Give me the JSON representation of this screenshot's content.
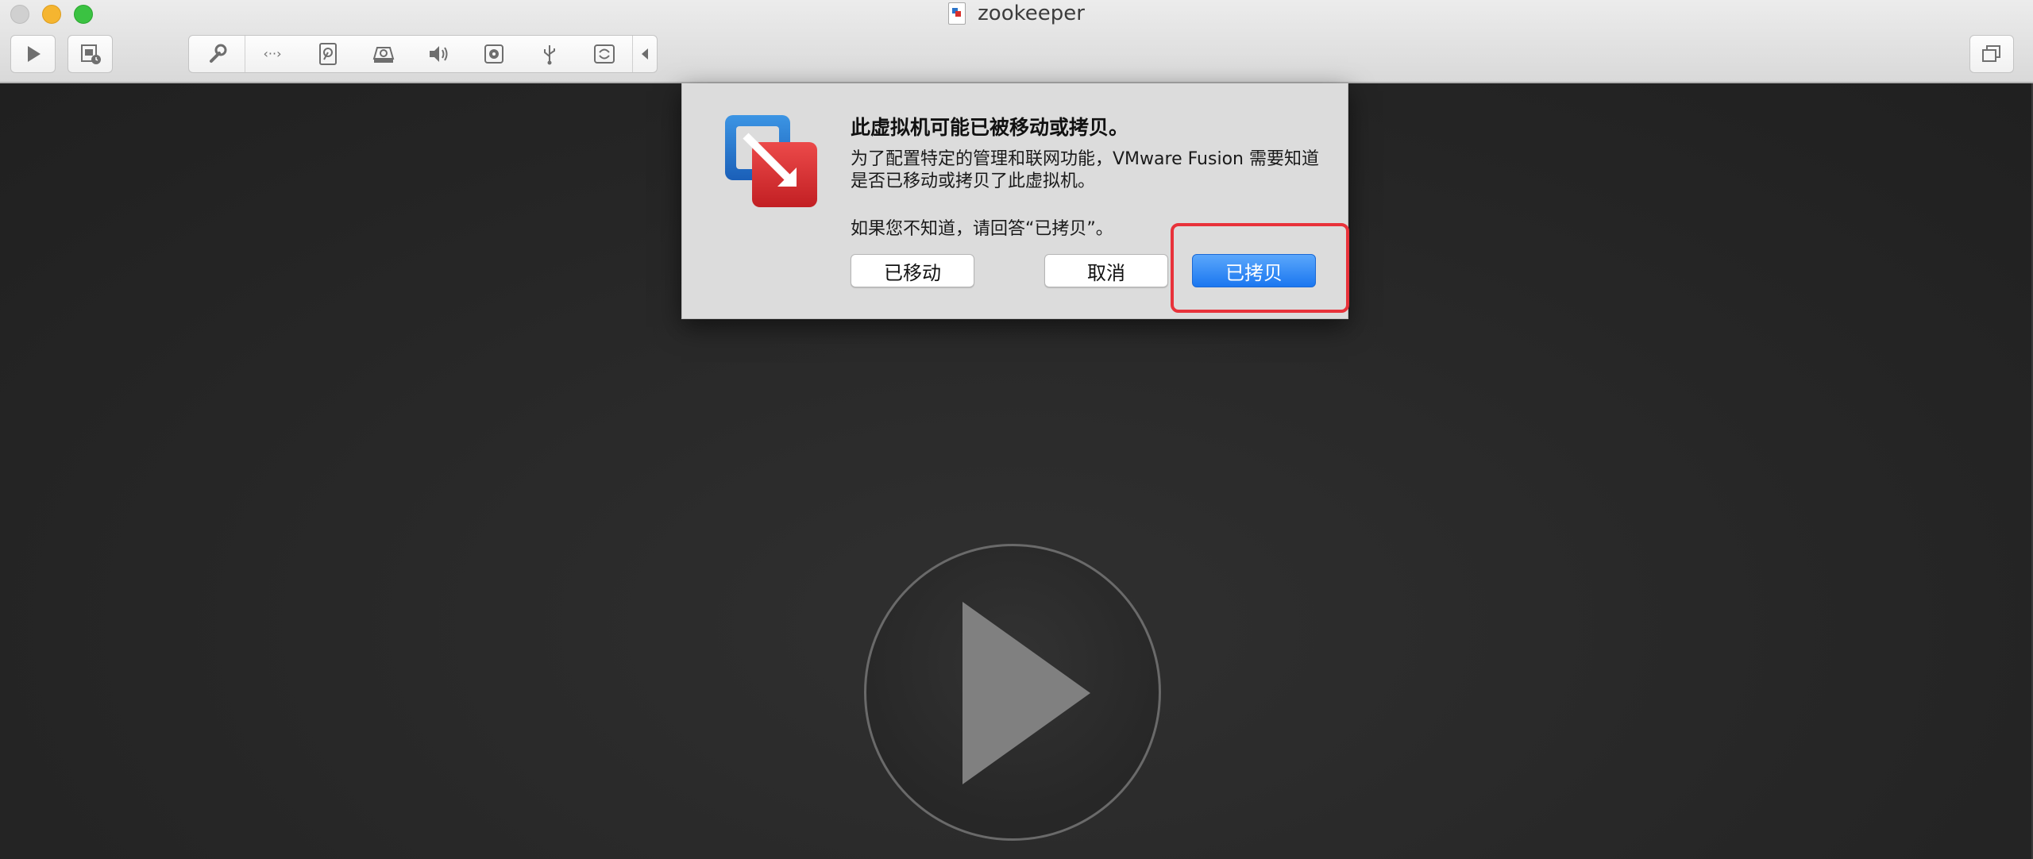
{
  "window": {
    "title": "zookeeper"
  },
  "toolbar": {
    "left_buttons": [
      {
        "name": "play",
        "icon": "play-icon"
      },
      {
        "name": "snapshot",
        "icon": "snapshot-icon"
      }
    ],
    "group_icons": [
      "wrench-icon",
      "network-icon",
      "hard-disk-icon",
      "optical-drive-icon",
      "sound-icon",
      "camera-icon",
      "usb-icon",
      "sync-icon",
      "chevron-left-icon"
    ],
    "right_button": {
      "icon": "fullscreen-icon"
    }
  },
  "dialog": {
    "title": "此虚拟机可能已被移动或拷贝。",
    "body": "为了配置特定的管理和联网功能，VMware Fusion 需要知道是否已移动或拷贝了此虚拟机。",
    "hint": "如果您不知道，请回答“已拷贝”。",
    "buttons": {
      "moved": "已移动",
      "cancel": "取消",
      "copied": "已拷贝"
    }
  },
  "colors": {
    "primary_button": "#1b77f0",
    "highlight_box": "#e8323a"
  }
}
